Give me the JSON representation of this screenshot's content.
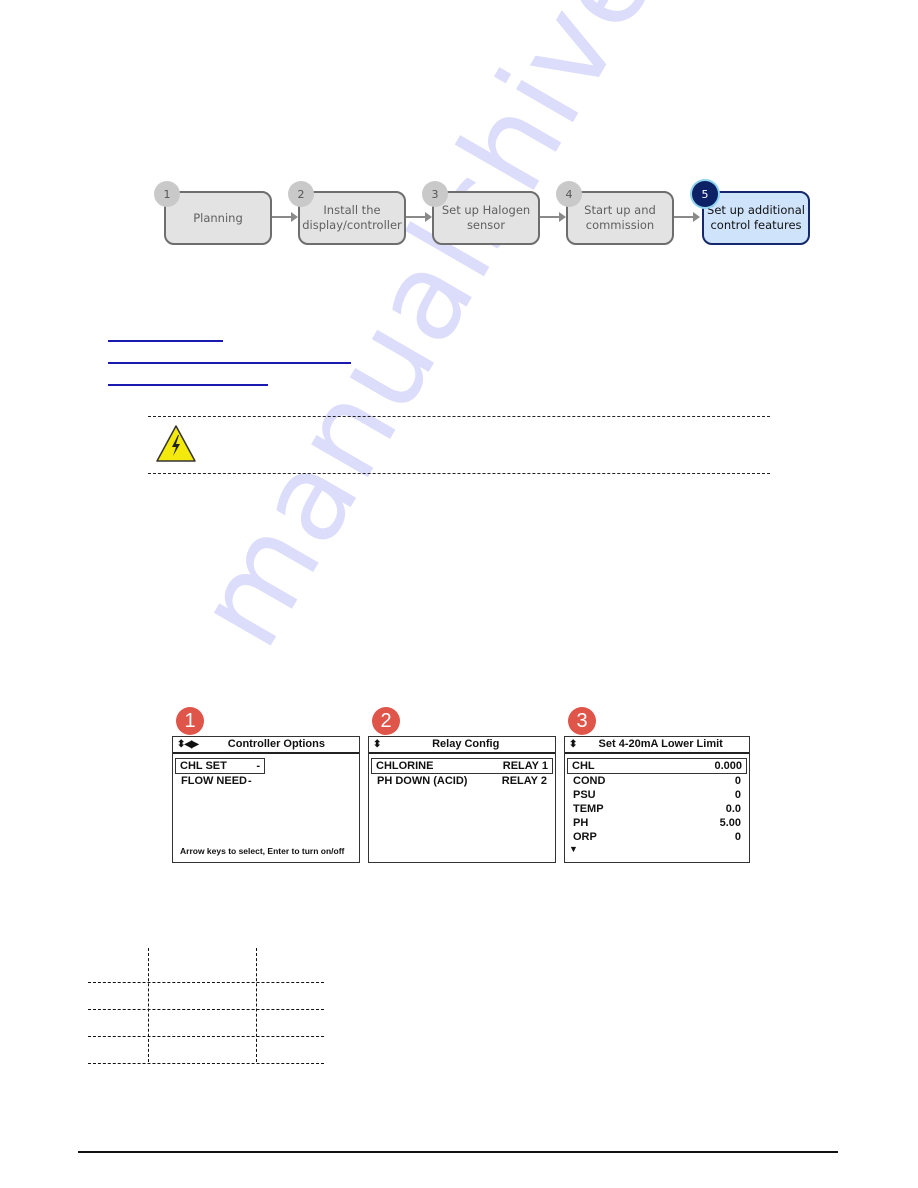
{
  "watermark": "manualshive.com",
  "workflow": {
    "steps": [
      {
        "number": "1",
        "label_line1": "Planning",
        "label_line2": "",
        "active": false
      },
      {
        "number": "2",
        "label_line1": "Install the",
        "label_line2": "display/controller",
        "active": false
      },
      {
        "number": "3",
        "label_line1": "Set up Halogen",
        "label_line2": "sensor",
        "active": false
      },
      {
        "number": "4",
        "label_line1": "Start up and",
        "label_line2": "commission",
        "active": false
      },
      {
        "number": "5",
        "label_line1": "Set up additional",
        "label_line2": "control features",
        "active": true
      }
    ],
    "active_color": "#0d2266",
    "active_fill": "#cfe4fb"
  },
  "links": [
    {
      "label": ""
    },
    {
      "label": ""
    },
    {
      "label": ""
    }
  ],
  "warning": {
    "icon": "electrical-hazard-icon",
    "text": ""
  },
  "screens": [
    {
      "badge": "1",
      "title": "Controller Options",
      "nav_icons": "⬍◀▶",
      "rows": [
        {
          "label": "CHL SET",
          "value": "-",
          "selected": true
        },
        {
          "label": "FLOW NEED",
          "value": "-",
          "selected": false
        }
      ],
      "footer": "Arrow keys to select, Enter to turn on/off"
    },
    {
      "badge": "2",
      "title": "Relay Config",
      "nav_icons": "⬍",
      "rows": [
        {
          "label": "CHLORINE",
          "value": "RELAY 1",
          "selected": true
        },
        {
          "label": "PH DOWN (ACID)",
          "value": "RELAY 2",
          "selected": false
        }
      ]
    },
    {
      "badge": "3",
      "title": "Set 4-20mA Lower Limit",
      "nav_icons": "⬍",
      "rows": [
        {
          "label": "CHL",
          "value": "0.000",
          "selected": true
        },
        {
          "label": "COND",
          "value": "0",
          "selected": false
        },
        {
          "label": "PSU",
          "value": "0",
          "selected": false
        },
        {
          "label": "TEMP",
          "value": "0.0",
          "selected": false
        },
        {
          "label": "PH",
          "value": "5.00",
          "selected": false
        },
        {
          "label": "ORP",
          "value": "0",
          "selected": false
        }
      ],
      "more_indicator": "▼"
    }
  ]
}
